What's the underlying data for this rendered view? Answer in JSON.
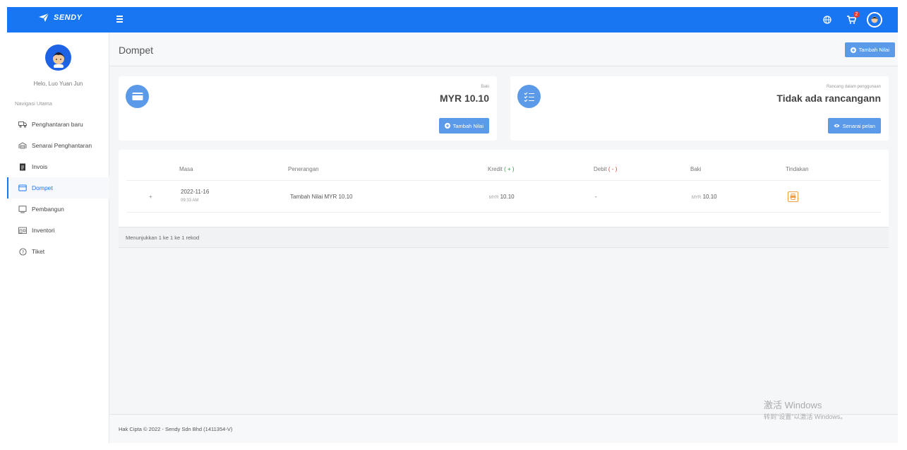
{
  "topbar": {
    "brand": "SENDY",
    "cart_count": "2"
  },
  "sidebar": {
    "greeting": "Helo, Luo Yuan Jun",
    "nav_title": "Navigasi Utama",
    "items": [
      {
        "label": "Penghantaran baru",
        "icon": "truck-icon"
      },
      {
        "label": "Senarai Penghantaran",
        "icon": "warehouse-icon"
      },
      {
        "label": "Invois",
        "icon": "invoice-icon"
      },
      {
        "label": "Dompet",
        "icon": "wallet-icon",
        "active": true
      },
      {
        "label": "Pembangun",
        "icon": "monitor-icon"
      },
      {
        "label": "Inventori",
        "icon": "inventory-icon"
      },
      {
        "label": "Tiket",
        "icon": "help-circle-icon"
      }
    ]
  },
  "header": {
    "title": "Dompet",
    "button": "Tambah Nilai"
  },
  "balance_card": {
    "label": "Baki",
    "value": "MYR 10.10",
    "button": "Tambah Nilai"
  },
  "plan_card": {
    "label": "Rancang dalam penggunaan",
    "value": "Tidak ada rancangann",
    "button": "Senarai pelan"
  },
  "table": {
    "headers": {
      "masa": "Masa",
      "penerangan": "Penerangan",
      "kredit": "Kredit",
      "kredit_sign": "( + )",
      "debit": "Debit",
      "debit_sign": "( - )",
      "baki": "Baki",
      "tindakan": "Tindakan"
    },
    "rows": [
      {
        "expand": "+",
        "date": "2022-11-16",
        "time": "09:33 AM",
        "description": "Tambah Nilai MYR 10.10",
        "credit_currency": "MYR",
        "credit": "10.10",
        "debit": "-",
        "balance_currency": "MYR",
        "balance": "10.10"
      }
    ],
    "footer": "Menunjukkan 1 ke 1 ke 1 rekod"
  },
  "footer": {
    "copyright": "Hak Cipta © 2022 - Sendy Sdn Bhd (1411354-V)"
  },
  "watermark": {
    "line1": "激活 Windows",
    "line2": "转到\"设置\"以激活 Windows。"
  },
  "colors": {
    "primary": "#1876f2",
    "button": "#5b9ae8",
    "action": "#f0a046"
  }
}
